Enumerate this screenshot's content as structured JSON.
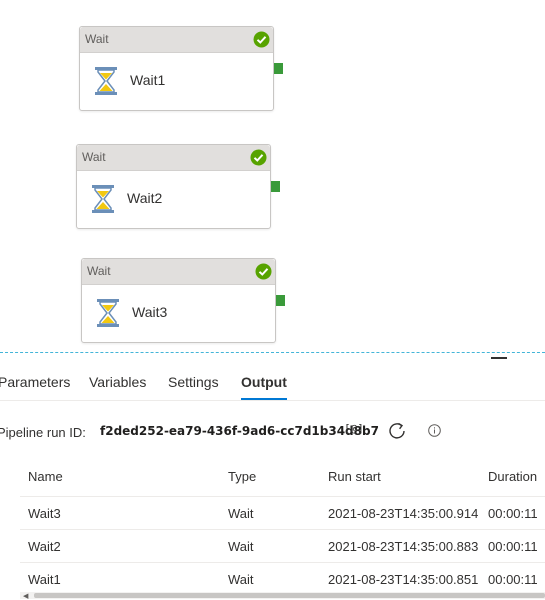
{
  "activities": [
    {
      "type": "Wait",
      "name": "Wait1",
      "status": "succeeded"
    },
    {
      "type": "Wait",
      "name": "Wait2",
      "status": "succeeded"
    },
    {
      "type": "Wait",
      "name": "Wait3",
      "status": "succeeded"
    }
  ],
  "colors": {
    "success": "#57a300",
    "port": "#3a9a3a",
    "accent": "#0078d4",
    "hourglass_frame": "#6b8fb8",
    "hourglass_sand": "#f2c811"
  },
  "tabs": [
    {
      "label": "Parameters",
      "active": false
    },
    {
      "label": "Variables",
      "active": false
    },
    {
      "label": "Settings",
      "active": false
    },
    {
      "label": "Output",
      "active": true
    }
  ],
  "run": {
    "label": "Pipeline run ID:",
    "id": "f2ded252-ea79-436f-9ad6-cc7d1b34d8b7",
    "copy_glyph": "[@]",
    "refresh_icon": "refresh-icon",
    "info_icon": "info-icon"
  },
  "table": {
    "headers": {
      "name": "Name",
      "type": "Type",
      "run_start": "Run start",
      "duration": "Duration"
    },
    "rows": [
      {
        "name": "Wait3",
        "type": "Wait",
        "run_start": "2021-08-23T14:35:00.914",
        "duration": "00:00:11"
      },
      {
        "name": "Wait2",
        "type": "Wait",
        "run_start": "2021-08-23T14:35:00.883",
        "duration": "00:00:11"
      },
      {
        "name": "Wait1",
        "type": "Wait",
        "run_start": "2021-08-23T14:35:00.851",
        "duration": "00:00:11"
      }
    ]
  }
}
